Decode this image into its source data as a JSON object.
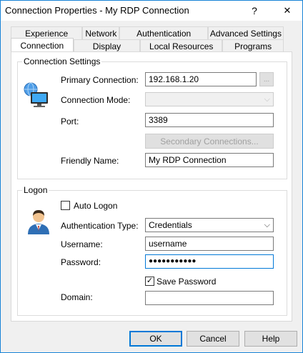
{
  "window": {
    "title": "Connection Properties - My RDP Connection",
    "help_glyph": "?",
    "close_glyph": "✕"
  },
  "tabs_row1": [
    "Experience",
    "Network",
    "Authentication",
    "Advanced Settings"
  ],
  "tabs_row2": [
    "Connection",
    "Display",
    "Local Resources",
    "Programs"
  ],
  "active_tab": "Connection",
  "connection_settings": {
    "group_label": "Connection Settings",
    "primary_label": "Primary Connection:",
    "primary_value": "192.168.1.20",
    "browse_label": "...",
    "mode_label": "Connection Mode:",
    "mode_value": "",
    "port_label": "Port:",
    "port_value": "3389",
    "secondary_button": "Secondary Connections...",
    "friendly_label": "Friendly Name:",
    "friendly_value": "My RDP Connection"
  },
  "logon": {
    "group_label": "Logon",
    "auto_logon_label": "Auto Logon",
    "auto_logon_checked": false,
    "auth_type_label": "Authentication Type:",
    "auth_type_value": "Credentials",
    "username_label": "Username:",
    "username_value": "username",
    "password_label": "Password:",
    "password_value": "●●●●●●●●●●●",
    "save_password_label": "Save Password",
    "save_password_checked": true,
    "domain_label": "Domain:",
    "domain_value": ""
  },
  "footer": {
    "ok": "OK",
    "cancel": "Cancel",
    "help": "Help"
  },
  "colors": {
    "accent": "#0078d7",
    "window_border": "#1883d7"
  }
}
